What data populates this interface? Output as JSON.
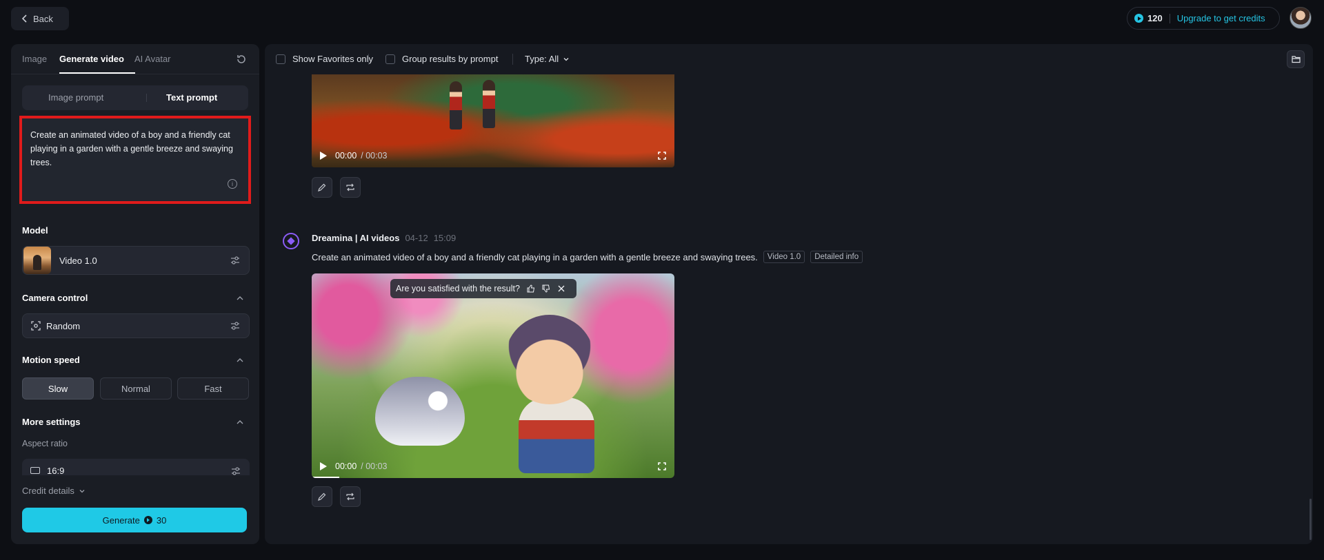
{
  "topbar": {
    "back_label": "Back",
    "credits": "120",
    "upgrade_label": "Upgrade to get credits"
  },
  "left_panel": {
    "tabs": [
      {
        "label": "Image",
        "active": false
      },
      {
        "label": "Generate video",
        "active": true
      },
      {
        "label": "AI Avatar",
        "active": false
      }
    ],
    "prompt_modes": [
      {
        "label": "Image prompt",
        "active": false
      },
      {
        "label": "Text prompt",
        "active": true
      }
    ],
    "prompt_text": "Create an animated video of a boy and a friendly cat playing in a garden with a gentle breeze and swaying trees.",
    "model": {
      "title": "Model",
      "value": "Video 1.0"
    },
    "camera": {
      "title": "Camera control",
      "value": "Random"
    },
    "motion": {
      "title": "Motion speed",
      "options": [
        "Slow",
        "Normal",
        "Fast"
      ],
      "selected": "Slow"
    },
    "more_settings": {
      "title": "More settings",
      "aspect_label": "Aspect ratio",
      "aspect_value": "16:9"
    },
    "credit_details": "Credit details",
    "generate": {
      "label": "Generate",
      "cost": "30"
    }
  },
  "main": {
    "filters": {
      "favorites": "Show Favorites only",
      "group": "Group results by prompt",
      "type": "Type: All"
    },
    "video_top": {
      "time_current": "00:00",
      "time_total": "/ 00:03"
    },
    "generation": {
      "name": "Dreamina | AI videos",
      "date": "04-12",
      "time": "15:09",
      "prompt": "Create an animated video of a boy and a friendly cat playing in a garden with a gentle breeze and swaying trees.",
      "model_tag": "Video 1.0",
      "info_tag": "Detailed info",
      "feedback_question": "Are you satisfied with the result?",
      "time_current": "00:00",
      "time_total": "/ 00:03"
    }
  },
  "colors": {
    "accent": "#1fc9e6",
    "highlight_border": "#e01b1b",
    "bot": "#8b5cf6"
  }
}
